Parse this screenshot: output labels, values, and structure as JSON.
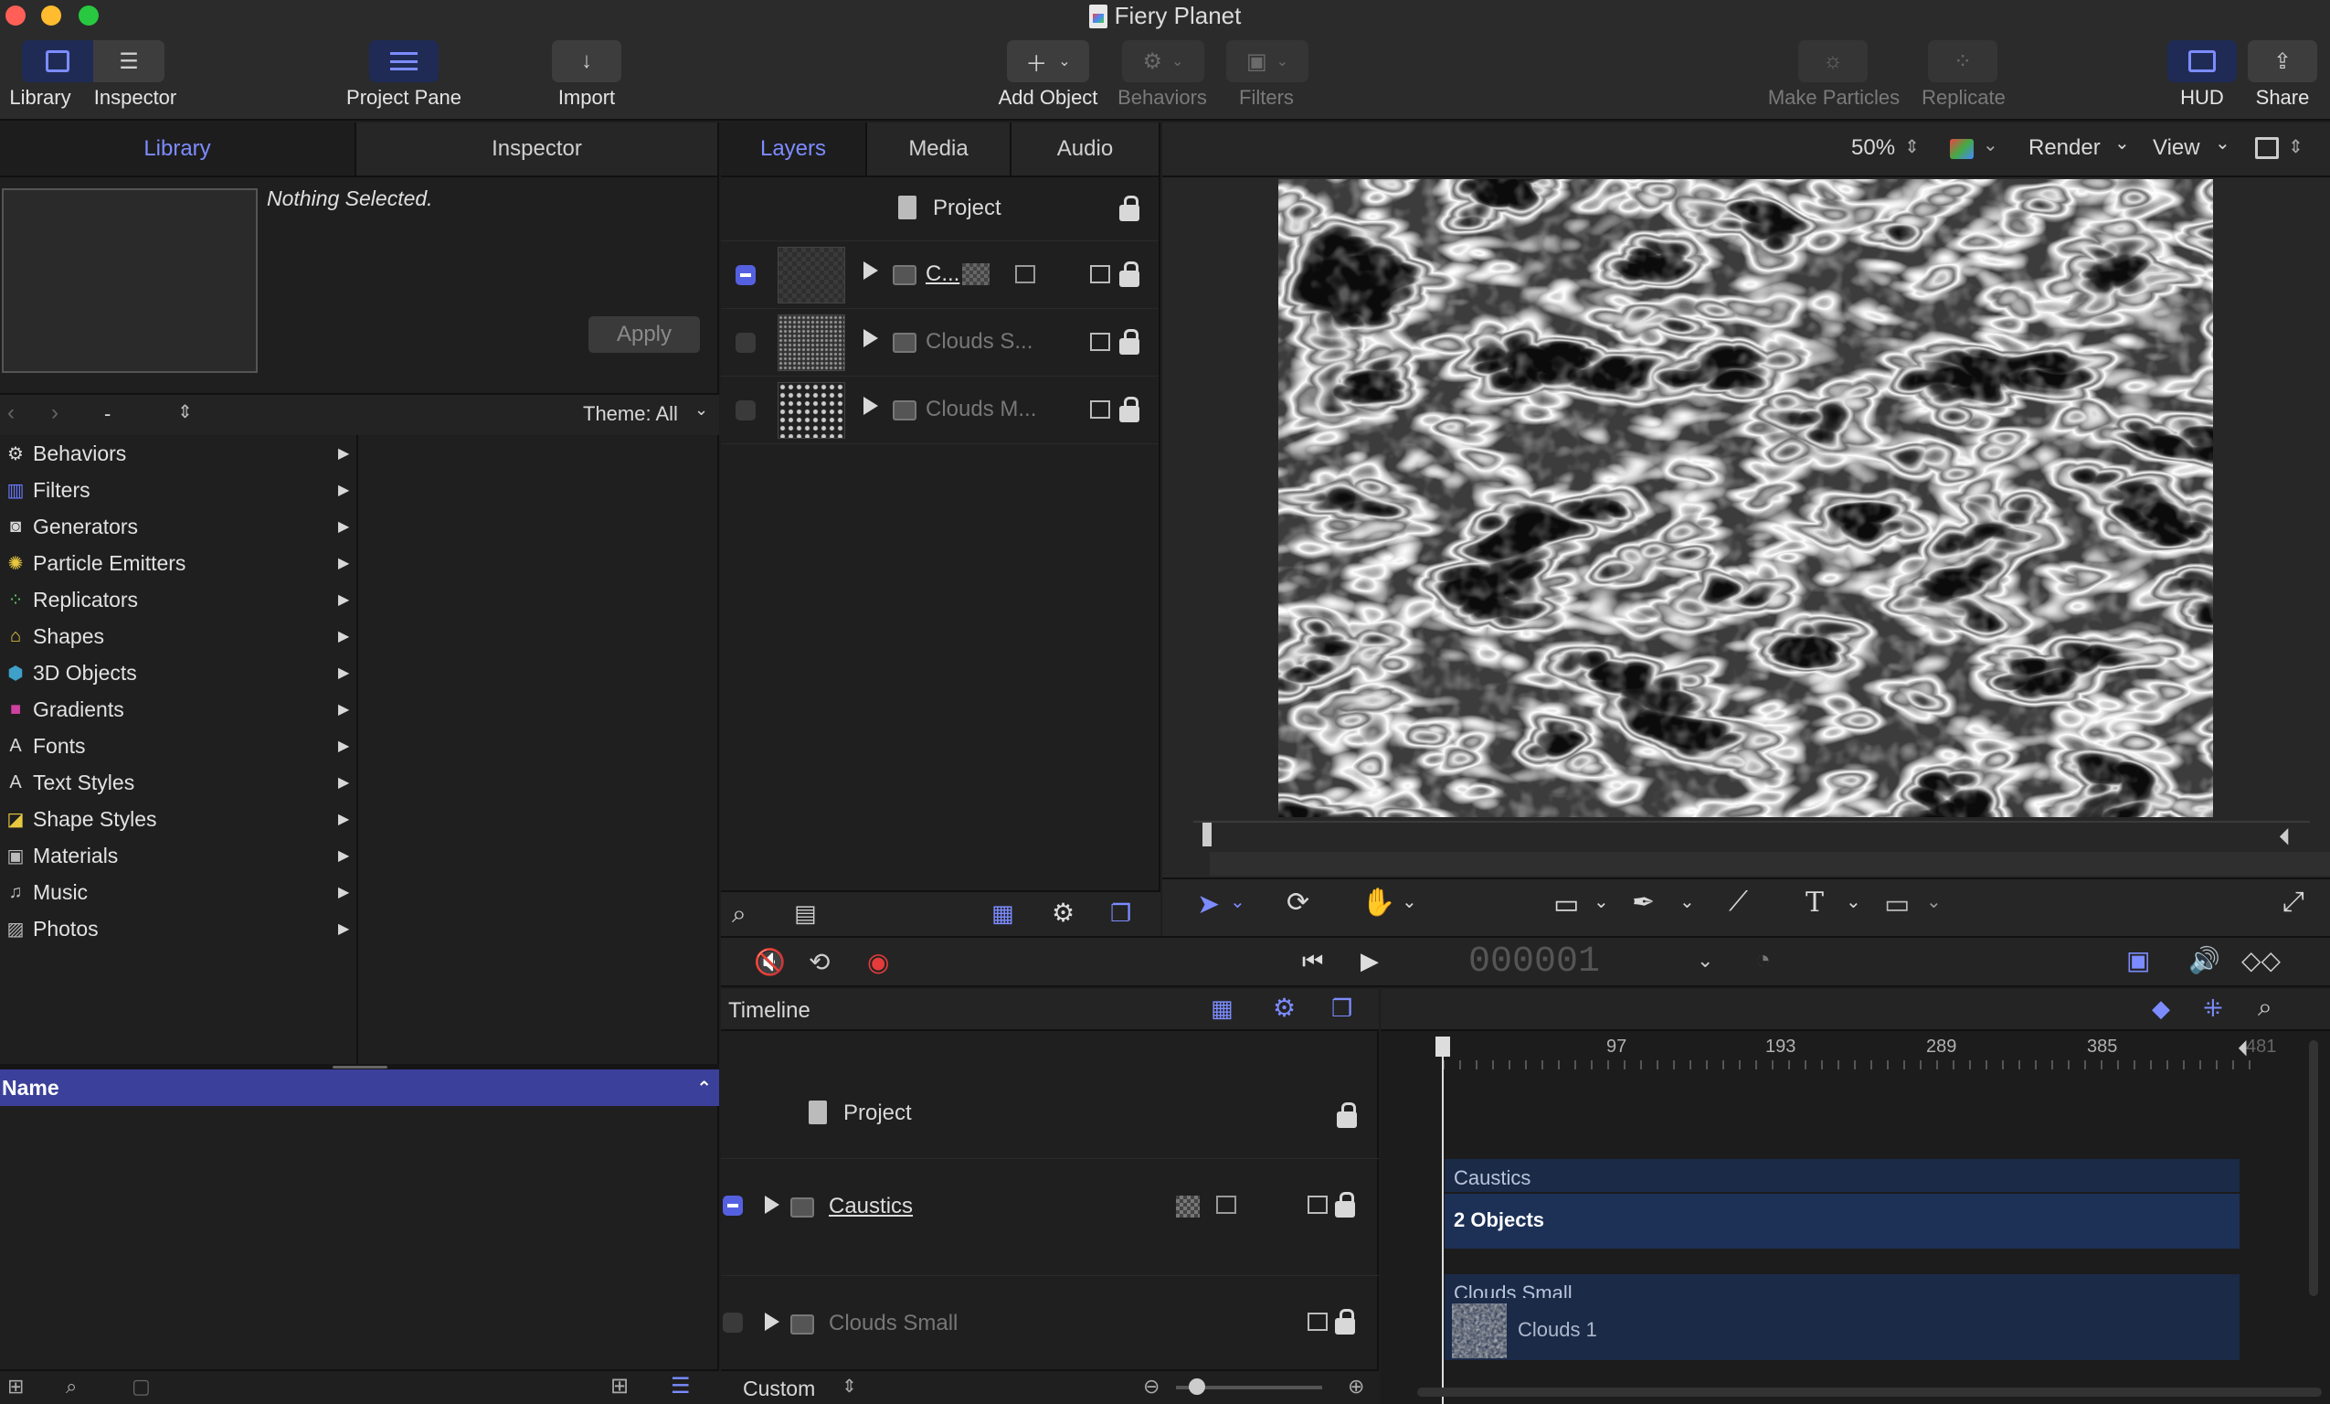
{
  "window": {
    "title": "Fiery Planet",
    "traffic_lights": [
      "#ff5f57",
      "#febc2e",
      "#28c840"
    ]
  },
  "toolbar": {
    "library": "Library",
    "inspector": "Inspector",
    "project_pane": "Project Pane",
    "import": "Import",
    "add_object": "Add Object",
    "behaviors": "Behaviors",
    "filters": "Filters",
    "make_particles": "Make Particles",
    "replicate": "Replicate",
    "hud": "HUD",
    "share": "Share"
  },
  "left_panel": {
    "tabs": [
      "Library",
      "Inspector"
    ],
    "preview_text": "Nothing Selected.",
    "apply_button": "Apply",
    "nav_path": "-",
    "theme_filter": "Theme: All",
    "categories": [
      {
        "label": "Behaviors",
        "icon": "gear-icon",
        "color": "#d8d8d8"
      },
      {
        "label": "Filters",
        "icon": "film-icon",
        "color": "#6a7bff"
      },
      {
        "label": "Generators",
        "icon": "generator-icon",
        "color": "#d8d8d8"
      },
      {
        "label": "Particle Emitters",
        "icon": "emitter-icon",
        "color": "#e8c840"
      },
      {
        "label": "Replicators",
        "icon": "replicator-icon",
        "color": "#5ec75e"
      },
      {
        "label": "Shapes",
        "icon": "shape-icon",
        "color": "#e8c840"
      },
      {
        "label": "3D Objects",
        "icon": "cube-icon",
        "color": "#3fa0c8"
      },
      {
        "label": "Gradients",
        "icon": "gradient-icon",
        "color": "#d040a0"
      },
      {
        "label": "Fonts",
        "icon": "font-icon",
        "color": "#d8d8d8"
      },
      {
        "label": "Text Styles",
        "icon": "text-style-icon",
        "color": "#d8d8d8"
      },
      {
        "label": "Shape Styles",
        "icon": "shape-style-icon",
        "color": "#e8c840"
      },
      {
        "label": "Materials",
        "icon": "material-icon",
        "color": "#bbbbbb"
      },
      {
        "label": "Music",
        "icon": "music-icon",
        "color": "#bbbbbb"
      },
      {
        "label": "Photos",
        "icon": "photo-icon",
        "color": "#bbbbbb"
      }
    ],
    "list_header": "Name"
  },
  "layers_pane": {
    "tabs": [
      "Layers",
      "Media",
      "Audio"
    ],
    "project_label": "Project",
    "layers": [
      {
        "name": "C...",
        "checked": true,
        "active": true
      },
      {
        "name": "Clouds S...",
        "checked": false,
        "active": false
      },
      {
        "name": "Clouds M...",
        "checked": false,
        "active": false
      }
    ]
  },
  "canvas": {
    "zoom": "50%",
    "render_menu": "Render",
    "view_menu": "View"
  },
  "transport": {
    "timecode": "000001"
  },
  "timeline": {
    "title": "Timeline",
    "project_label": "Project",
    "tracks": [
      {
        "name": "Caustics",
        "checked": true,
        "active": true
      },
      {
        "name": "Clouds Small",
        "checked": false,
        "active": false
      }
    ],
    "ruler_marks": [
      "97",
      "193",
      "289",
      "385",
      "481"
    ],
    "bars": {
      "caustics_group": "Caustics",
      "caustics_count": "2 Objects",
      "clouds_group": "Clouds Small",
      "clouds_item": "Clouds 1"
    },
    "zoom_preset": "Custom"
  }
}
